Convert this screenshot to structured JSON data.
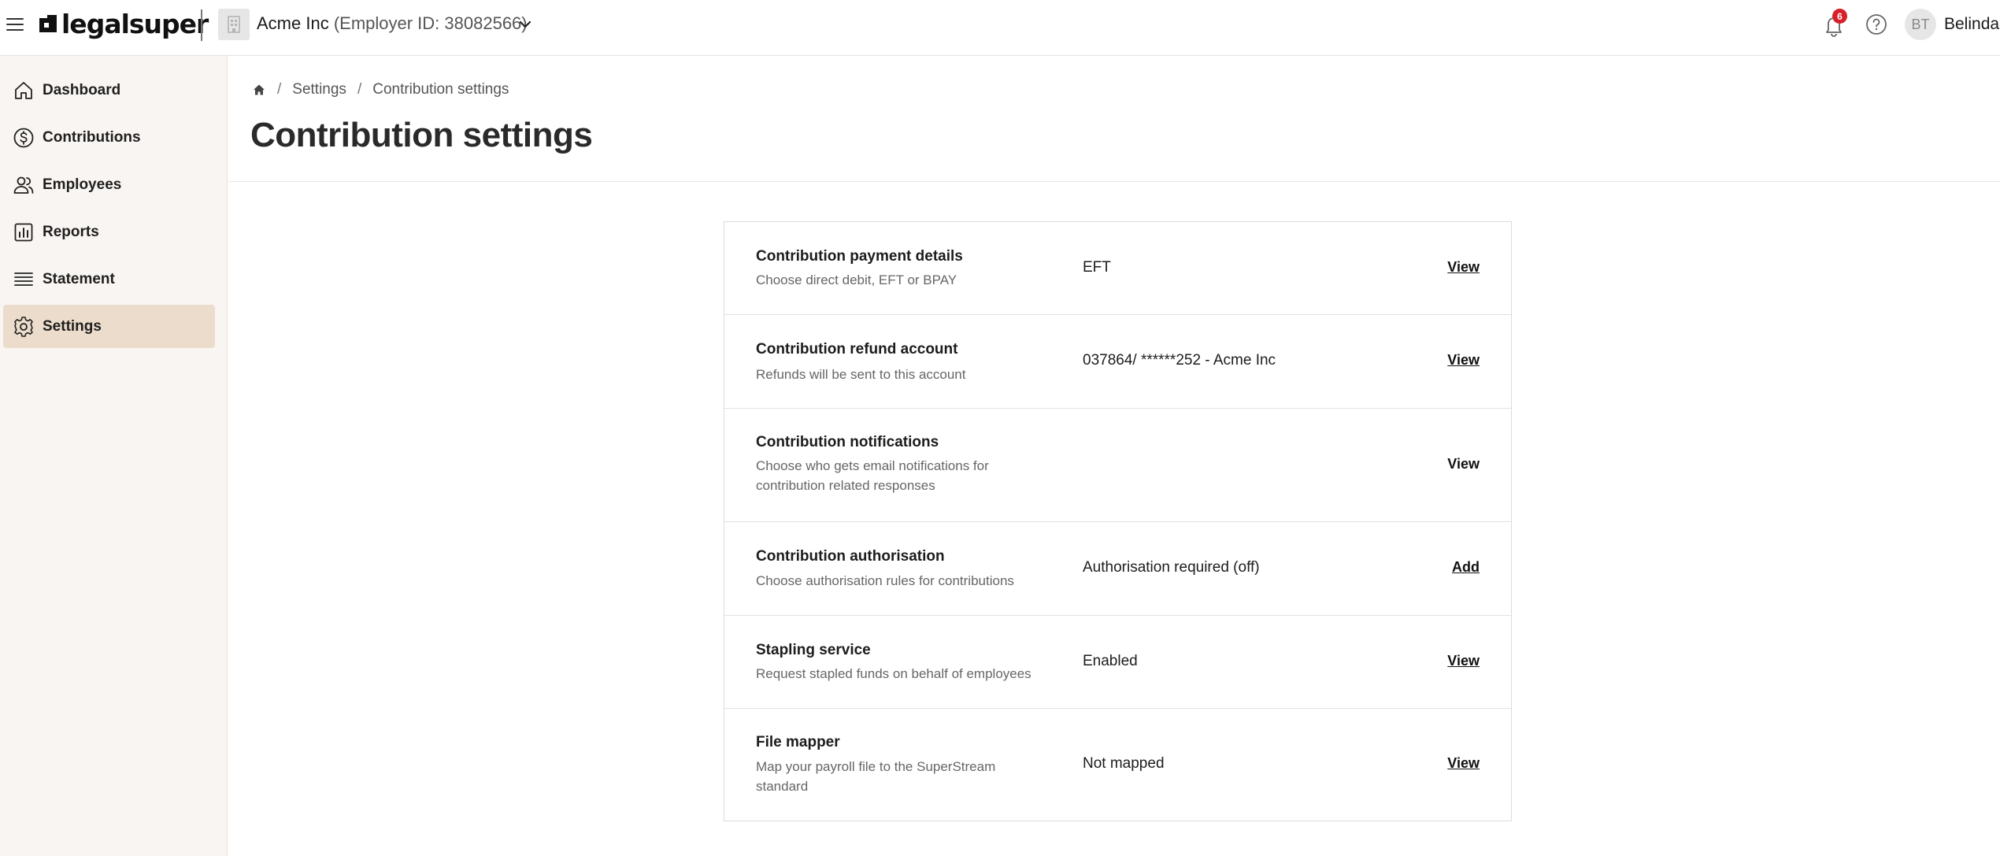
{
  "header": {
    "brand": "legalsuper",
    "org_name": "Acme Inc",
    "org_id_text": "(Employer ID: 38082566)",
    "notification_count": "6",
    "user_initials": "BT",
    "user_name": "Belinda",
    "icons": [
      "menu-icon",
      "building-icon",
      "chevron-down-icon",
      "bell-icon",
      "help-icon"
    ]
  },
  "sidebar": {
    "items": [
      {
        "label": "Dashboard",
        "icon": "home-icon",
        "active": false
      },
      {
        "label": "Contributions",
        "icon": "dollar-circle-icon",
        "active": false
      },
      {
        "label": "Employees",
        "icon": "people-icon",
        "active": false
      },
      {
        "label": "Reports",
        "icon": "bar-chart-icon",
        "active": false
      },
      {
        "label": "Statement",
        "icon": "list-icon",
        "active": false
      },
      {
        "label": "Settings",
        "icon": "gear-icon",
        "active": true
      }
    ],
    "active_color": "#ecdccb"
  },
  "breadcrumb": {
    "items": [
      "Settings",
      "Contribution settings"
    ],
    "separator": "/"
  },
  "page": {
    "title": "Contribution settings"
  },
  "settings": {
    "rows": [
      {
        "title": "Contribution payment details",
        "desc_line1": "Choose direct debit, EFT or BPAY",
        "desc_line2": "",
        "value": "EFT",
        "action": "View"
      },
      {
        "title": "Contribution refund account",
        "desc_line1": "Refunds will be sent to this account",
        "desc_line2": "",
        "value": "037864/ ******252 - Acme Inc",
        "action": "View"
      },
      {
        "title": "Contribution notifications",
        "desc_line1": "Choose who gets email notifications for",
        "desc_line2": "contribution related responses",
        "value": "",
        "action": "View"
      },
      {
        "title": "Contribution authorisation",
        "desc_line1": "Choose authorisation rules for contributions",
        "desc_line2": "",
        "value": "Authorisation required (off)",
        "action": "Add"
      },
      {
        "title": "Stapling service",
        "desc_line1": "Request stapled funds on behalf of employees",
        "desc_line2": "",
        "value": "Enabled",
        "action": "View"
      },
      {
        "title": "File mapper",
        "desc_line1": "Map your payroll file to the SuperStream",
        "desc_line2": "standard",
        "value": "Not mapped",
        "action": "View"
      }
    ]
  },
  "colors": {
    "badge": "#d6202a",
    "sidebar_bg": "#f9f5f2"
  }
}
